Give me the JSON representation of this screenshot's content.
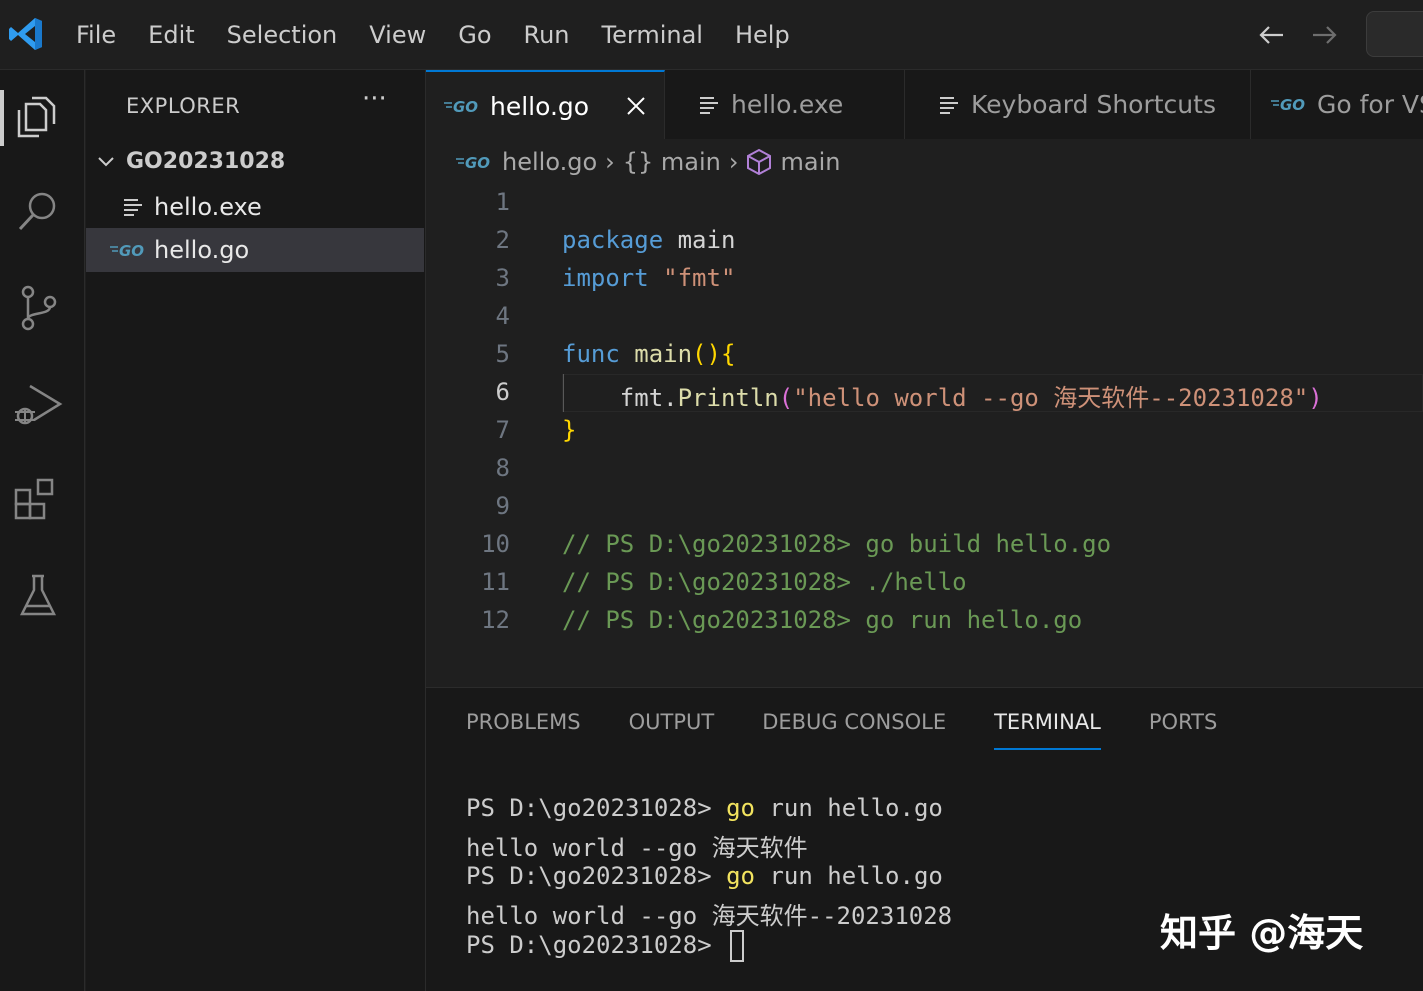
{
  "menu": [
    "File",
    "Edit",
    "Selection",
    "View",
    "Go",
    "Run",
    "Terminal",
    "Help"
  ],
  "explorer": {
    "title": "EXPLORER",
    "more": "···",
    "folder": "GO20231028",
    "files": [
      {
        "name": "hello.exe",
        "icon": "file-lines-icon"
      },
      {
        "name": "hello.go",
        "icon": "go-file-icon",
        "selected": true
      }
    ]
  },
  "tabs": [
    {
      "label": "hello.go",
      "icon": "go-file-icon",
      "active": true
    },
    {
      "label": "hello.exe",
      "icon": "file-lines-icon"
    },
    {
      "label": "Keyboard Shortcuts",
      "icon": "file-lines-icon"
    },
    {
      "label": "Go for VS",
      "icon": "go-file-icon"
    }
  ],
  "breadcrumb": {
    "file": "hello.go",
    "scope": "{} main",
    "symbol": "main"
  },
  "editor": {
    "line_numbers": [
      "1",
      "2",
      "3",
      "4",
      "5",
      "6",
      "7",
      "8",
      "9",
      "10",
      "11",
      "12"
    ],
    "current_line": 6,
    "l2_kw": "package",
    "l2_rest": " main",
    "l3_kw": "import",
    "l3_str": "\"fmt\"",
    "l5_kw": "func",
    "l5_fn": "main",
    "l5_paren": "()",
    "l5_brace": "{",
    "l6_obj": "fmt.",
    "l6_fn": "Println",
    "l6_paren_open": "(",
    "l6_str": "\"hello world --go 海天软件--20231028\"",
    "l6_paren_close": ")",
    "l7_brace": "}",
    "l10": "// PS D:\\go20231028> go build hello.go",
    "l11": "// PS D:\\go20231028> ./hello",
    "l12": "// PS D:\\go20231028> go run hello.go"
  },
  "panel": {
    "tabs": [
      "PROBLEMS",
      "OUTPUT",
      "DEBUG CONSOLE",
      "TERMINAL",
      "PORTS"
    ],
    "active_tab": "TERMINAL",
    "terminal": {
      "prompt": "PS D:\\go20231028> ",
      "cmd1": "go",
      "cmd1_rest": " run hello.go",
      "out1": "hello world --go 海天软件",
      "cmd2": "go",
      "cmd2_rest": " run hello.go",
      "out2": "hello world --go 海天软件--20231028"
    }
  },
  "watermark": "知乎 @海天",
  "colors": {
    "accent": "#0078d4",
    "keyword": "#569cd6",
    "string": "#ce9178",
    "comment": "#6a9955",
    "function": "#dcdcaa"
  }
}
